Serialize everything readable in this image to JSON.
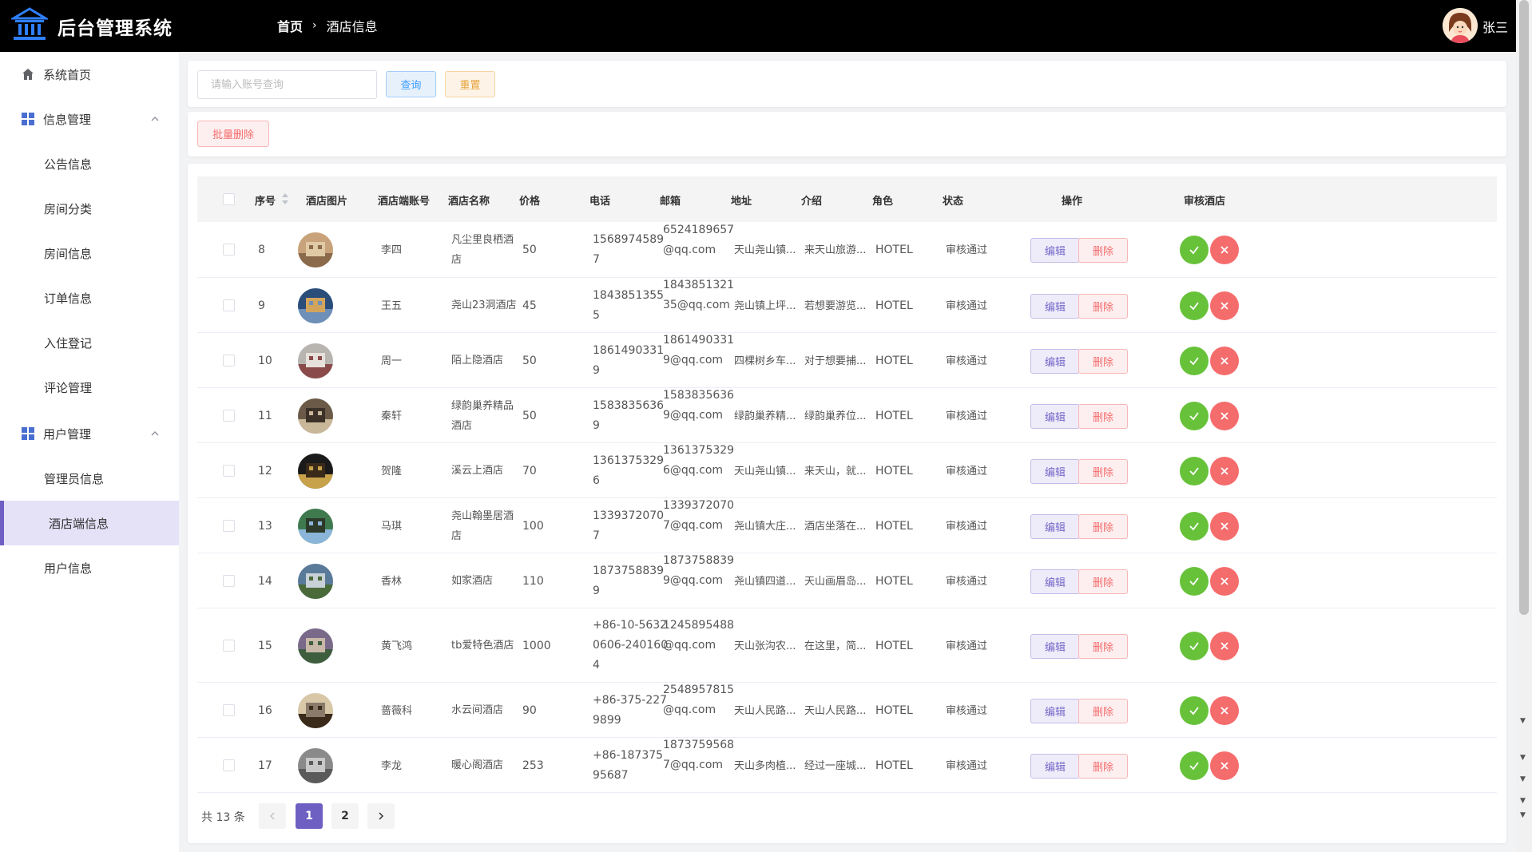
{
  "header": {
    "app_title": "后台管理系统",
    "breadcrumb_home": "首页",
    "breadcrumb_current": "酒店信息",
    "username": "张三"
  },
  "sidebar": {
    "items": [
      {
        "label": "系统首页",
        "icon": "home-icon"
      },
      {
        "label": "信息管理",
        "icon": "grid-icon",
        "expanded": true
      },
      {
        "label": "公告信息"
      },
      {
        "label": "房间分类"
      },
      {
        "label": "房间信息"
      },
      {
        "label": "订单信息"
      },
      {
        "label": "入住登记"
      },
      {
        "label": "评论管理"
      },
      {
        "label": "用户管理",
        "icon": "grid-icon",
        "expanded": true
      },
      {
        "label": "管理员信息"
      },
      {
        "label": "酒店端信息",
        "active": true
      },
      {
        "label": "用户信息"
      }
    ]
  },
  "search": {
    "placeholder": "请输入账号查询",
    "query_label": "查询",
    "reset_label": "重置"
  },
  "actions": {
    "batch_delete_label": "批量删除"
  },
  "table": {
    "columns": [
      "序号",
      "酒店图片",
      "酒店端账号",
      "酒店名称",
      "价格",
      "电话",
      "邮箱",
      "地址",
      "介绍",
      "角色",
      "状态",
      "操作",
      "审核酒店"
    ],
    "edit_label": "编辑",
    "delete_label": "删除",
    "rows": [
      {
        "id": "8",
        "account": "李四",
        "name1": "凡尘里良栖酒",
        "name2": "店",
        "price": "50",
        "phone1": "1568974589",
        "phone2": "7",
        "phone3": "",
        "email1": "6524189657",
        "email2": "@qq.com",
        "address": "天山尧山镇...",
        "intro": "来天山旅游...",
        "role": "HOTEL",
        "status": "审核通过"
      },
      {
        "id": "9",
        "account": "王五",
        "name1": "尧山23洞酒店",
        "name2": "",
        "price": "45",
        "phone1": "1843851355",
        "phone2": "5",
        "phone3": "",
        "email1": "1843851321",
        "email2": "35@qq.com",
        "address": "尧山镇上坪...",
        "intro": "若想要游览...",
        "role": "HOTEL",
        "status": "审核通过"
      },
      {
        "id": "10",
        "account": "周一",
        "name1": "陌上隐酒店",
        "name2": "",
        "price": "50",
        "phone1": "1861490331",
        "phone2": "9",
        "phone3": "",
        "email1": "1861490331",
        "email2": "9@qq.com",
        "address": "四棵树乡车...",
        "intro": "对于想要捕...",
        "role": "HOTEL",
        "status": "审核通过"
      },
      {
        "id": "11",
        "account": "秦轩",
        "name1": "绿韵巢养精品",
        "name2": "酒店",
        "price": "50",
        "phone1": "1583835636",
        "phone2": "9",
        "phone3": "",
        "email1": "1583835636",
        "email2": "9@qq.com",
        "address": "绿韵巢养精...",
        "intro": "绿韵巢养位...",
        "role": "HOTEL",
        "status": "审核通过"
      },
      {
        "id": "12",
        "account": "贺隆",
        "name1": "溪云上酒店",
        "name2": "",
        "price": "70",
        "phone1": "1361375329",
        "phone2": "6",
        "phone3": "",
        "email1": "1361375329",
        "email2": "6@qq.com",
        "address": "天山尧山镇...",
        "intro": "来天山，就...",
        "role": "HOTEL",
        "status": "审核通过"
      },
      {
        "id": "13",
        "account": "马琪",
        "name1": "尧山翰墨居酒",
        "name2": "店",
        "price": "100",
        "phone1": "1339372070",
        "phone2": "7",
        "phone3": "",
        "email1": "1339372070",
        "email2": "7@qq.com",
        "address": "尧山镇大庄...",
        "intro": "酒店坐落在...",
        "role": "HOTEL",
        "status": "审核通过"
      },
      {
        "id": "14",
        "account": "香林",
        "name1": "如家酒店",
        "name2": "",
        "price": "110",
        "phone1": "1873758839",
        "phone2": "9",
        "phone3": "",
        "email1": "1873758839",
        "email2": "9@qq.com",
        "address": "尧山镇四道...",
        "intro": "天山画眉岛...",
        "role": "HOTEL",
        "status": "审核通过"
      },
      {
        "id": "15",
        "account": "黄飞鸿",
        "name1": "tb爱特色酒店",
        "name2": "",
        "price": "1000",
        "phone1": "+86-10-5632",
        "phone2": "0606-240160",
        "phone3": "4",
        "email1": "1245895488",
        "email2": "@qq.com",
        "address": "天山张沟农...",
        "intro": "在这里，简...",
        "role": "HOTEL",
        "status": "审核通过"
      },
      {
        "id": "16",
        "account": "蔷薇科",
        "name1": "水云间酒店",
        "name2": "",
        "price": "90",
        "phone1": "+86-375-227",
        "phone2": "9899",
        "phone3": "",
        "email1": "2548957815",
        "email2": "@qq.com",
        "address": "天山人民路...",
        "intro": "天山人民路...",
        "role": "HOTEL",
        "status": "审核通过"
      },
      {
        "id": "17",
        "account": "李龙",
        "name1": "暖心阁酒店",
        "name2": "",
        "price": "253",
        "phone1": "+86-187375",
        "phone2": "95687",
        "phone3": "",
        "email1": "1873759568",
        "email2": "7@qq.com",
        "address": "天山多肉植...",
        "intro": "经过一座城...",
        "role": "HOTEL",
        "status": "审核通过"
      }
    ]
  },
  "pagination": {
    "total_label": "共 13 条",
    "pages": [
      "1",
      "2"
    ],
    "current": "1"
  },
  "colors": {
    "accent": "#6e5fc3",
    "success": "#67c23a",
    "danger": "#f56c6c",
    "warning": "#e6a23c",
    "primary": "#409eff"
  }
}
